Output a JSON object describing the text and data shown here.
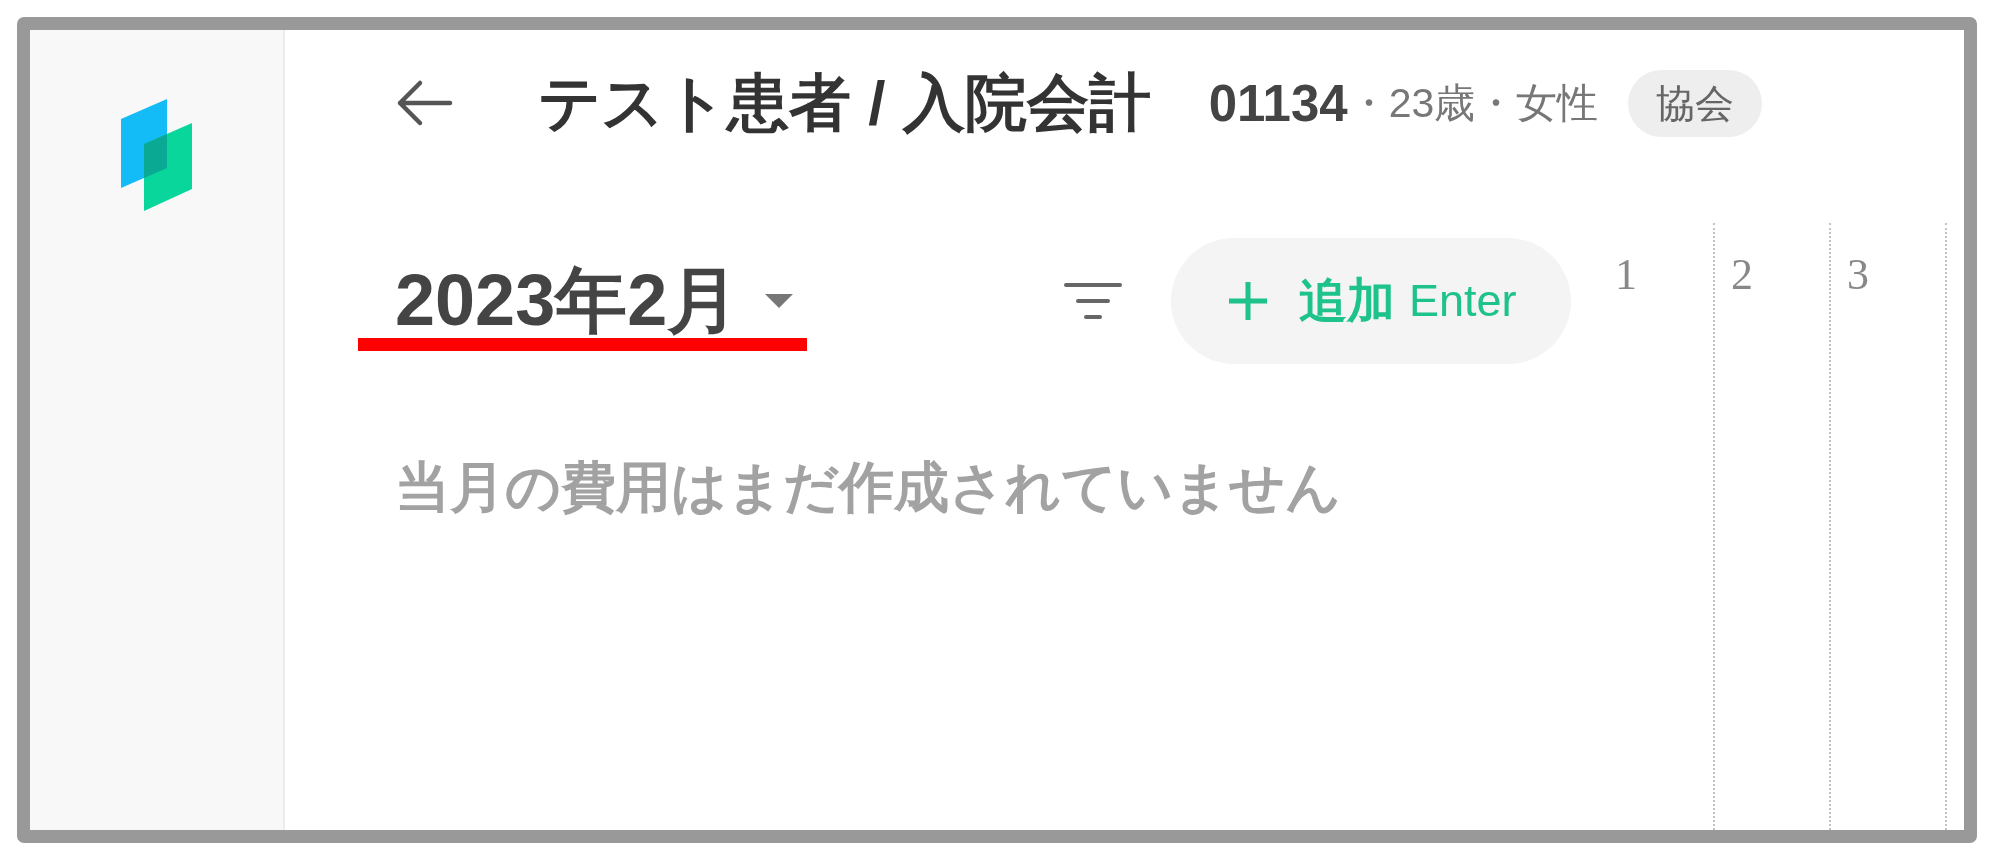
{
  "header": {
    "title": "テスト患者 / 入院会計",
    "patient_id": "01134",
    "details": "・23歳・女性",
    "badge": "協会"
  },
  "month_picker": {
    "label": "2023年2月",
    "underlined": true
  },
  "add_button": {
    "label": "追加",
    "shortcut": "Enter"
  },
  "empty_message": "当月の費用はまだ作成されていません",
  "timeline": {
    "days": [
      "1",
      "2",
      "3"
    ]
  }
}
